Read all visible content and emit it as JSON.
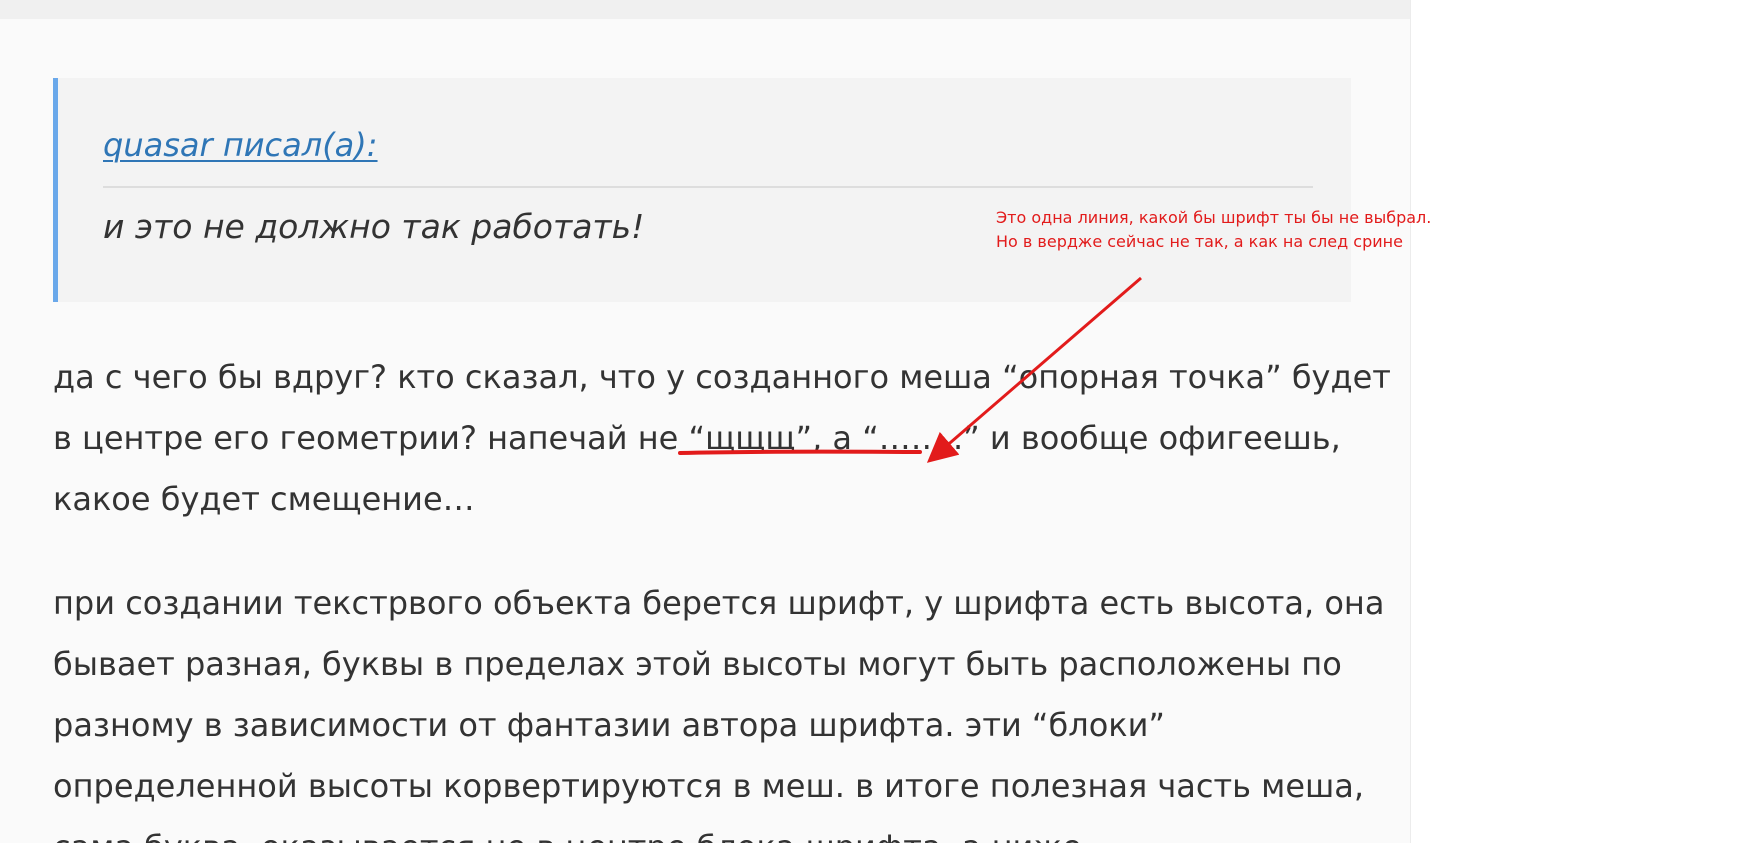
{
  "quote": {
    "author_link": "quasar писал(а):",
    "text": "и это не должно так работать!"
  },
  "post": {
    "paragraph1": [
      "да с чего бы вдруг? кто сказал, что у созданного меша “опорная точка” будет",
      "в центре его геометрии? напечай не “щщщ”, а “……..” и вообще офигеешь,",
      "какое будет смещение…"
    ],
    "paragraph2": [
      "при создании текстрвого объекта берется шрифт, у шрифта есть высота, она",
      "бывает разная, буквы в пределах этой высоты могут быть расположены по",
      "разному в зависимости от фантазии автора шрифта. эти “блоки”",
      "определенной высоты корвертируются в меш. в итоге полезная часть меша,",
      "сама буква, оказывается не в центре блока шрифта, а ниже"
    ]
  },
  "annotation": {
    "note_line1": "Это одна линия, какой бы шрифт ты бы не выбрал.",
    "note_line2": "Но в вердже сейчас не так, а как на след срине",
    "color": "#e21b1b"
  },
  "colors": {
    "link": "#2f76b6",
    "quote_border": "#6aa8ea",
    "text": "#333333"
  }
}
